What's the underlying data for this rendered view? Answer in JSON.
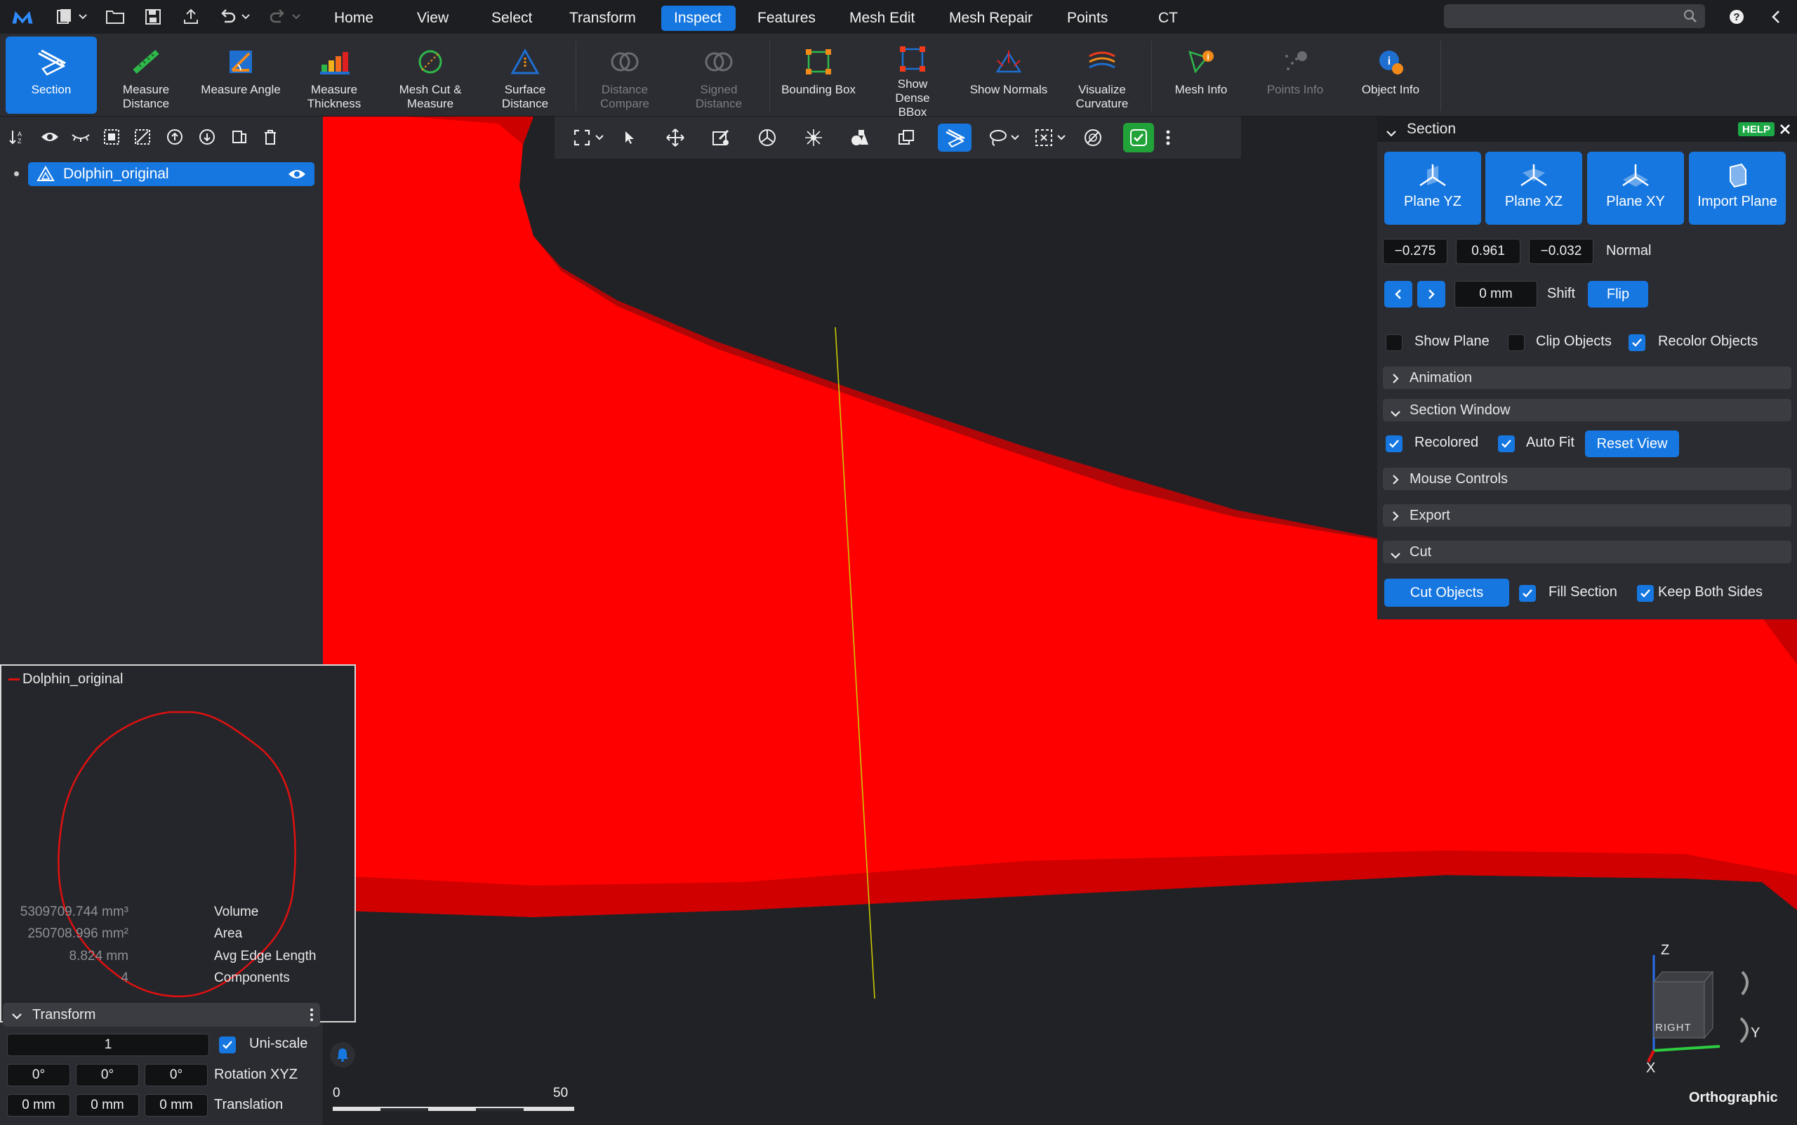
{
  "menu": {
    "tabs": [
      "Home",
      "View",
      "Select",
      "Transform",
      "Inspect",
      "Features",
      "Mesh Edit",
      "Mesh Repair",
      "Points",
      "CT"
    ],
    "active_tab": "Inspect",
    "search_placeholder": ""
  },
  "ribbon": {
    "items": [
      {
        "label": "Section",
        "state": "active"
      },
      {
        "label": "Measure Distance",
        "state": "normal"
      },
      {
        "label": "Measure Angle",
        "state": "normal"
      },
      {
        "label": "Measure Thickness",
        "state": "normal"
      },
      {
        "label": "Mesh Cut & Measure",
        "state": "normal"
      },
      {
        "label": "Surface Distance",
        "state": "normal"
      },
      {
        "label": "Distance Compare",
        "state": "disabled"
      },
      {
        "label": "Signed Distance",
        "state": "disabled"
      },
      {
        "label": "Bounding Box",
        "state": "normal"
      },
      {
        "label": "Show Dense BBox",
        "state": "normal"
      },
      {
        "label": "Show Normals",
        "state": "normal"
      },
      {
        "label": "Visualize Curvature",
        "state": "normal"
      },
      {
        "label": "Mesh Info",
        "state": "normal"
      },
      {
        "label": "Points Info",
        "state": "disabled"
      },
      {
        "label": "Object Info",
        "state": "normal"
      }
    ]
  },
  "scene": {
    "object_name": "Dolphin_original"
  },
  "section_window": {
    "legend": "Dolphin_original"
  },
  "info": {
    "volume_value": "5309709.744 mm³",
    "volume_label": "Volume",
    "area_value": "250708.996 mm²",
    "area_label": "Area",
    "edge_value": "8.824 mm",
    "edge_label": "Avg Edge Length",
    "components_value": "4",
    "components_label": "Components"
  },
  "transform": {
    "header": "Transform",
    "scale": "1",
    "uniscale_label": "Uni-scale",
    "rot_x": "0°",
    "rot_y": "0°",
    "rot_z": "0°",
    "rotation_label": "Rotation XYZ",
    "tr_x": "0 mm",
    "tr_y": "0 mm",
    "tr_z": "0 mm",
    "translation_label": "Translation"
  },
  "section_panel": {
    "title": "Section",
    "help": "HELP",
    "planes": [
      "Plane YZ",
      "Plane XZ",
      "Plane XY",
      "Import Plane"
    ],
    "normal_x": "−0.275",
    "normal_y": "0.961",
    "normal_z": "−0.032",
    "normal_label": "Normal",
    "shift_value": "0 mm",
    "shift_label": "Shift",
    "flip": "Flip",
    "show_plane": "Show Plane",
    "clip_objects": "Clip Objects",
    "recolor_objects": "Recolor Objects",
    "show_plane_checked": false,
    "clip_objects_checked": false,
    "recolor_objects_checked": true,
    "animation": "Animation",
    "section_window": "Section Window",
    "recolored": "Recolored",
    "auto_fit": "Auto Fit",
    "reset_view": "Reset View",
    "mouse_controls": "Mouse Controls",
    "export": "Export",
    "cut": "Cut",
    "cut_objects": "Cut Objects",
    "fill_section": "Fill Section",
    "keep_both_sides": "Keep Both Sides"
  },
  "scale_bar": {
    "start": "0",
    "end": "50"
  },
  "view_cube": {
    "face": "RIGHT",
    "axis_x": "X",
    "axis_y": "Y",
    "axis_z": "Z",
    "projection": "Orthographic"
  },
  "colors": {
    "accent": "#1677e0",
    "mesh": "#ff0000",
    "section_curve": "#e01010",
    "help_badge": "#1ca845"
  }
}
